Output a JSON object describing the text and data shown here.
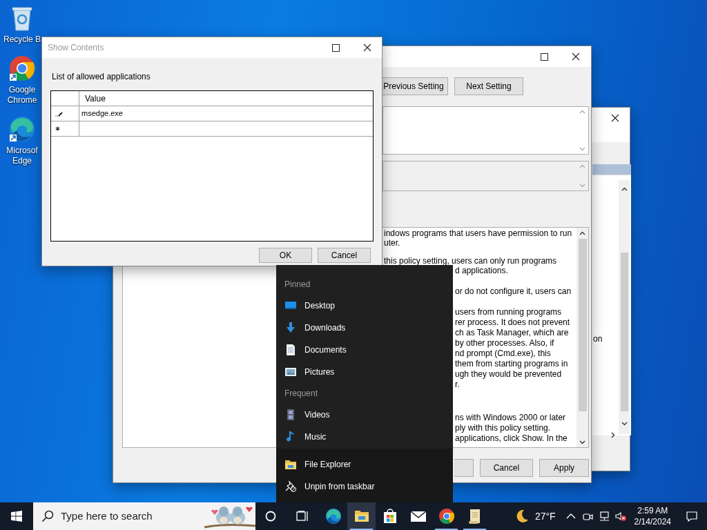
{
  "desktop_icons": [
    {
      "kind": "recycle",
      "label": "Recycle B"
    },
    {
      "kind": "chrome",
      "label": "Google Chrome"
    },
    {
      "kind": "edge",
      "label": "Microsof Edge"
    }
  ],
  "policy_window": {
    "nav_buttons": [
      "Previous Setting",
      "Next Setting"
    ],
    "help_upper": [
      [
        "indows programs that users have permission to run",
        "uter."
      ],
      [
        "this policy setting, users can only run programs"
      ]
    ],
    "help_lower": [
      [
        "d applications."
      ],
      [
        "or do not configure it, users can"
      ],
      [
        "users from running programs",
        "rer process.  It does not prevent",
        "ch as Task Manager, which are",
        "by other processes.  Also, if",
        "nd prompt (Cmd.exe), this",
        "them from starting programs in",
        "ugh they would be prevented",
        "r."
      ],
      [
        "ns with Windows 2000 or later",
        "ply with this policy setting.",
        "applications, click Show.  In the"
      ]
    ],
    "buttons": [
      "Cancel",
      "Apply"
    ]
  },
  "back_window": {
    "text": "on"
  },
  "show_contents": {
    "title": "Show Contents",
    "label": "List of allowed applications",
    "grid": {
      "columns": [
        "Value"
      ],
      "rows": [
        {
          "kind": "edit",
          "value": "msedge.exe"
        },
        {
          "kind": "new"
        }
      ]
    },
    "buttons": [
      "OK",
      "Cancel"
    ]
  },
  "jump_list": {
    "sections": [
      {
        "heading": "Pinned",
        "items": [
          {
            "kind": "desktop",
            "label": "Desktop"
          },
          {
            "kind": "downloads",
            "label": "Downloads"
          },
          {
            "kind": "documents",
            "label": "Documents"
          },
          {
            "kind": "pictures",
            "label": "Pictures"
          }
        ]
      },
      {
        "heading": "Frequent",
        "items": [
          {
            "kind": "videos",
            "label": "Videos"
          },
          {
            "kind": "music",
            "label": "Music"
          }
        ]
      }
    ],
    "tasks": [
      {
        "kind": "explorer",
        "label": "File Explorer"
      },
      {
        "kind": "unpin",
        "label": "Unpin from taskbar"
      }
    ]
  },
  "taskbar": {
    "search": {
      "hint": "Type here to search"
    },
    "apps": [
      {
        "kind": "edge",
        "running": false,
        "selected": false
      },
      {
        "kind": "explorer",
        "running": true,
        "selected": true
      },
      {
        "kind": "store",
        "running": false,
        "selected": false
      },
      {
        "kind": "mail",
        "running": false,
        "selected": false
      },
      {
        "kind": "chrome",
        "running": true,
        "selected": false
      },
      {
        "kind": "notes",
        "running": true,
        "selected": false
      }
    ],
    "weather": "27°F",
    "time": "2:59 AM",
    "date": "2/14/2024"
  }
}
